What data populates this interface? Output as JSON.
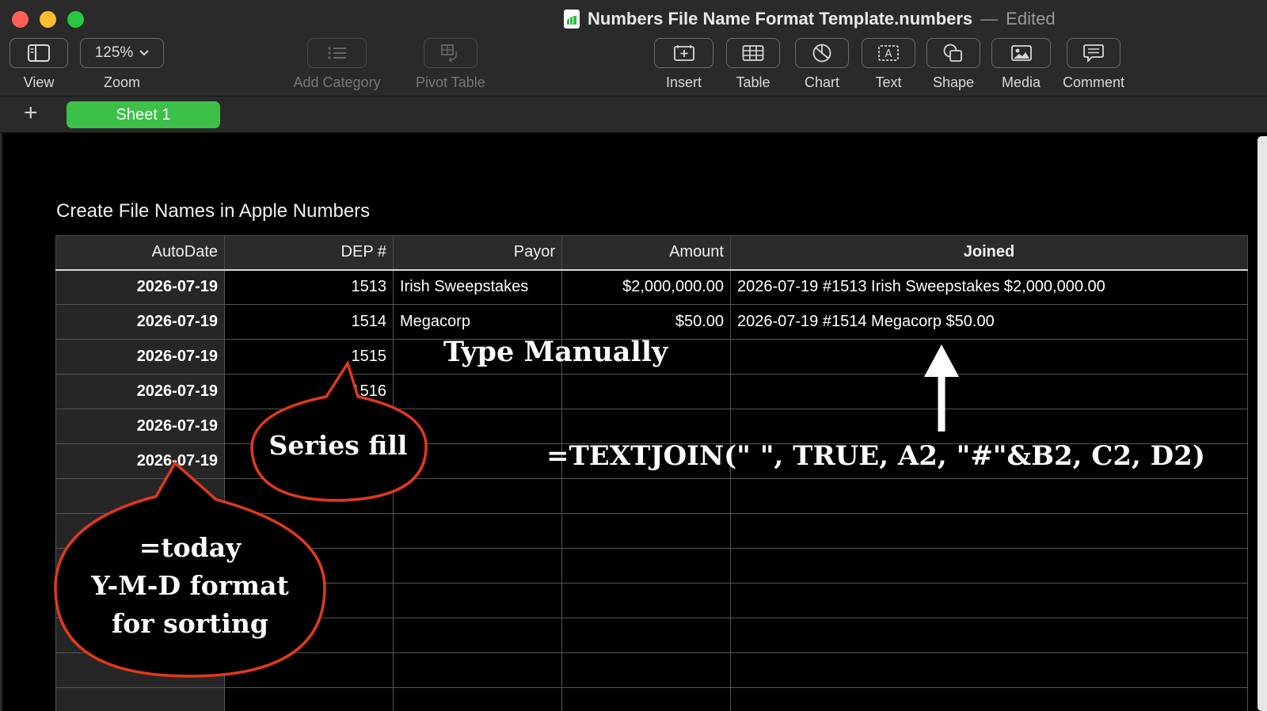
{
  "window": {
    "title": "Numbers File Name Format Template.numbers",
    "separator": "—",
    "state": "Edited"
  },
  "toolbar": {
    "view_label": "View",
    "zoom_value": "125%",
    "zoom_label": "Zoom",
    "add_category_label": "Add Category",
    "pivot_table_label": "Pivot Table",
    "insert_label": "Insert",
    "table_label": "Table",
    "chart_label": "Chart",
    "text_label": "Text",
    "shape_label": "Shape",
    "media_label": "Media",
    "comment_label": "Comment"
  },
  "sheets": {
    "add_label": "+",
    "tabs": [
      {
        "label": "Sheet 1",
        "active": true
      }
    ]
  },
  "table": {
    "title": "Create File Names in Apple Numbers",
    "headers": [
      "AutoDate",
      "DEP #",
      "Payor",
      "Amount",
      "Joined"
    ],
    "rows": [
      [
        "2026-07-19",
        "1513",
        "Irish Sweepstakes",
        "$2,000,000.00",
        "2026-07-19 #1513 Irish Sweepstakes $2,000,000.00"
      ],
      [
        "2026-07-19",
        "1514",
        "Megacorp",
        "$50.00",
        "2026-07-19 #1514 Megacorp $50.00"
      ],
      [
        "2026-07-19",
        "1515",
        "",
        "",
        ""
      ],
      [
        "2026-07-19",
        "1516",
        "",
        "",
        ""
      ],
      [
        "2026-07-19",
        "",
        "",
        "",
        ""
      ],
      [
        "2026-07-19",
        "",
        "",
        "",
        ""
      ],
      [
        "",
        "",
        "",
        "",
        ""
      ],
      [
        "",
        "",
        "",
        "",
        ""
      ],
      [
        "",
        "",
        "",
        "",
        ""
      ],
      [
        "",
        "",
        "",
        "",
        ""
      ],
      [
        "",
        "",
        "",
        "",
        ""
      ],
      [
        "",
        "",
        "",
        "",
        ""
      ],
      [
        "",
        "",
        "",
        "",
        ""
      ]
    ]
  },
  "annotations": {
    "type_manually": "Type Manually",
    "formula": "=TEXTJOIN(\" \", TRUE, A2, \"#\"&B2, C2, D2)",
    "series_fill": "Series fill",
    "today_line1": "=today",
    "today_line2": "Y-M-D format",
    "today_line3": "for sorting"
  },
  "colors": {
    "toolbar_bg": "#2a2a2a",
    "sheet_tab_active": "#3cc047",
    "callout_border": "#e0391d",
    "canvas_bg": "#000000"
  }
}
